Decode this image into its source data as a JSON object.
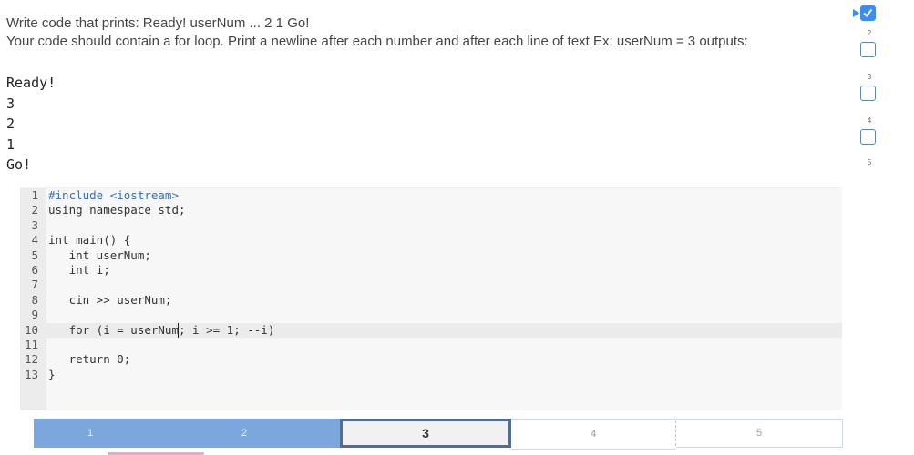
{
  "prompt": {
    "line1": "Write code that prints: Ready! userNum ... 2 1 Go!",
    "line2": "Your code should contain a for loop. Print a newline after each number and after each line of text Ex: userNum = 3 outputs:"
  },
  "example_output": [
    "Ready!",
    "3",
    "2",
    "1",
    "Go!"
  ],
  "editor": {
    "lines": [
      {
        "n": "1",
        "text": "#include <iostream>"
      },
      {
        "n": "2",
        "text": "using namespace std;"
      },
      {
        "n": "3",
        "text": ""
      },
      {
        "n": "4",
        "text": "int main() {"
      },
      {
        "n": "5",
        "text": "   int userNum;"
      },
      {
        "n": "6",
        "text": "   int i;"
      },
      {
        "n": "7",
        "text": ""
      },
      {
        "n": "8",
        "text": "   cin >> userNum;"
      },
      {
        "n": "9",
        "text": ""
      },
      {
        "n": "10",
        "text": "   for (i = userNum; i >= 1; --i)"
      },
      {
        "n": "11",
        "text": ""
      },
      {
        "n": "12",
        "text": "   return 0;"
      },
      {
        "n": "13",
        "text": "}"
      }
    ]
  },
  "progress": {
    "steps": [
      "1",
      "2",
      "3",
      "4",
      "5"
    ],
    "current": "3"
  },
  "level_nav": {
    "items": [
      {
        "number": "",
        "checked": true
      },
      {
        "number": "2",
        "checked": false
      },
      {
        "number": "3",
        "checked": false
      },
      {
        "number": "4",
        "checked": false
      },
      {
        "number": "5",
        "checked": false
      }
    ]
  },
  "colors": {
    "accent": "#3b8ef0",
    "progress_done": "#7ba7dd",
    "progress_current_border": "#4f6f94",
    "keyword": "#3a6fb5"
  }
}
